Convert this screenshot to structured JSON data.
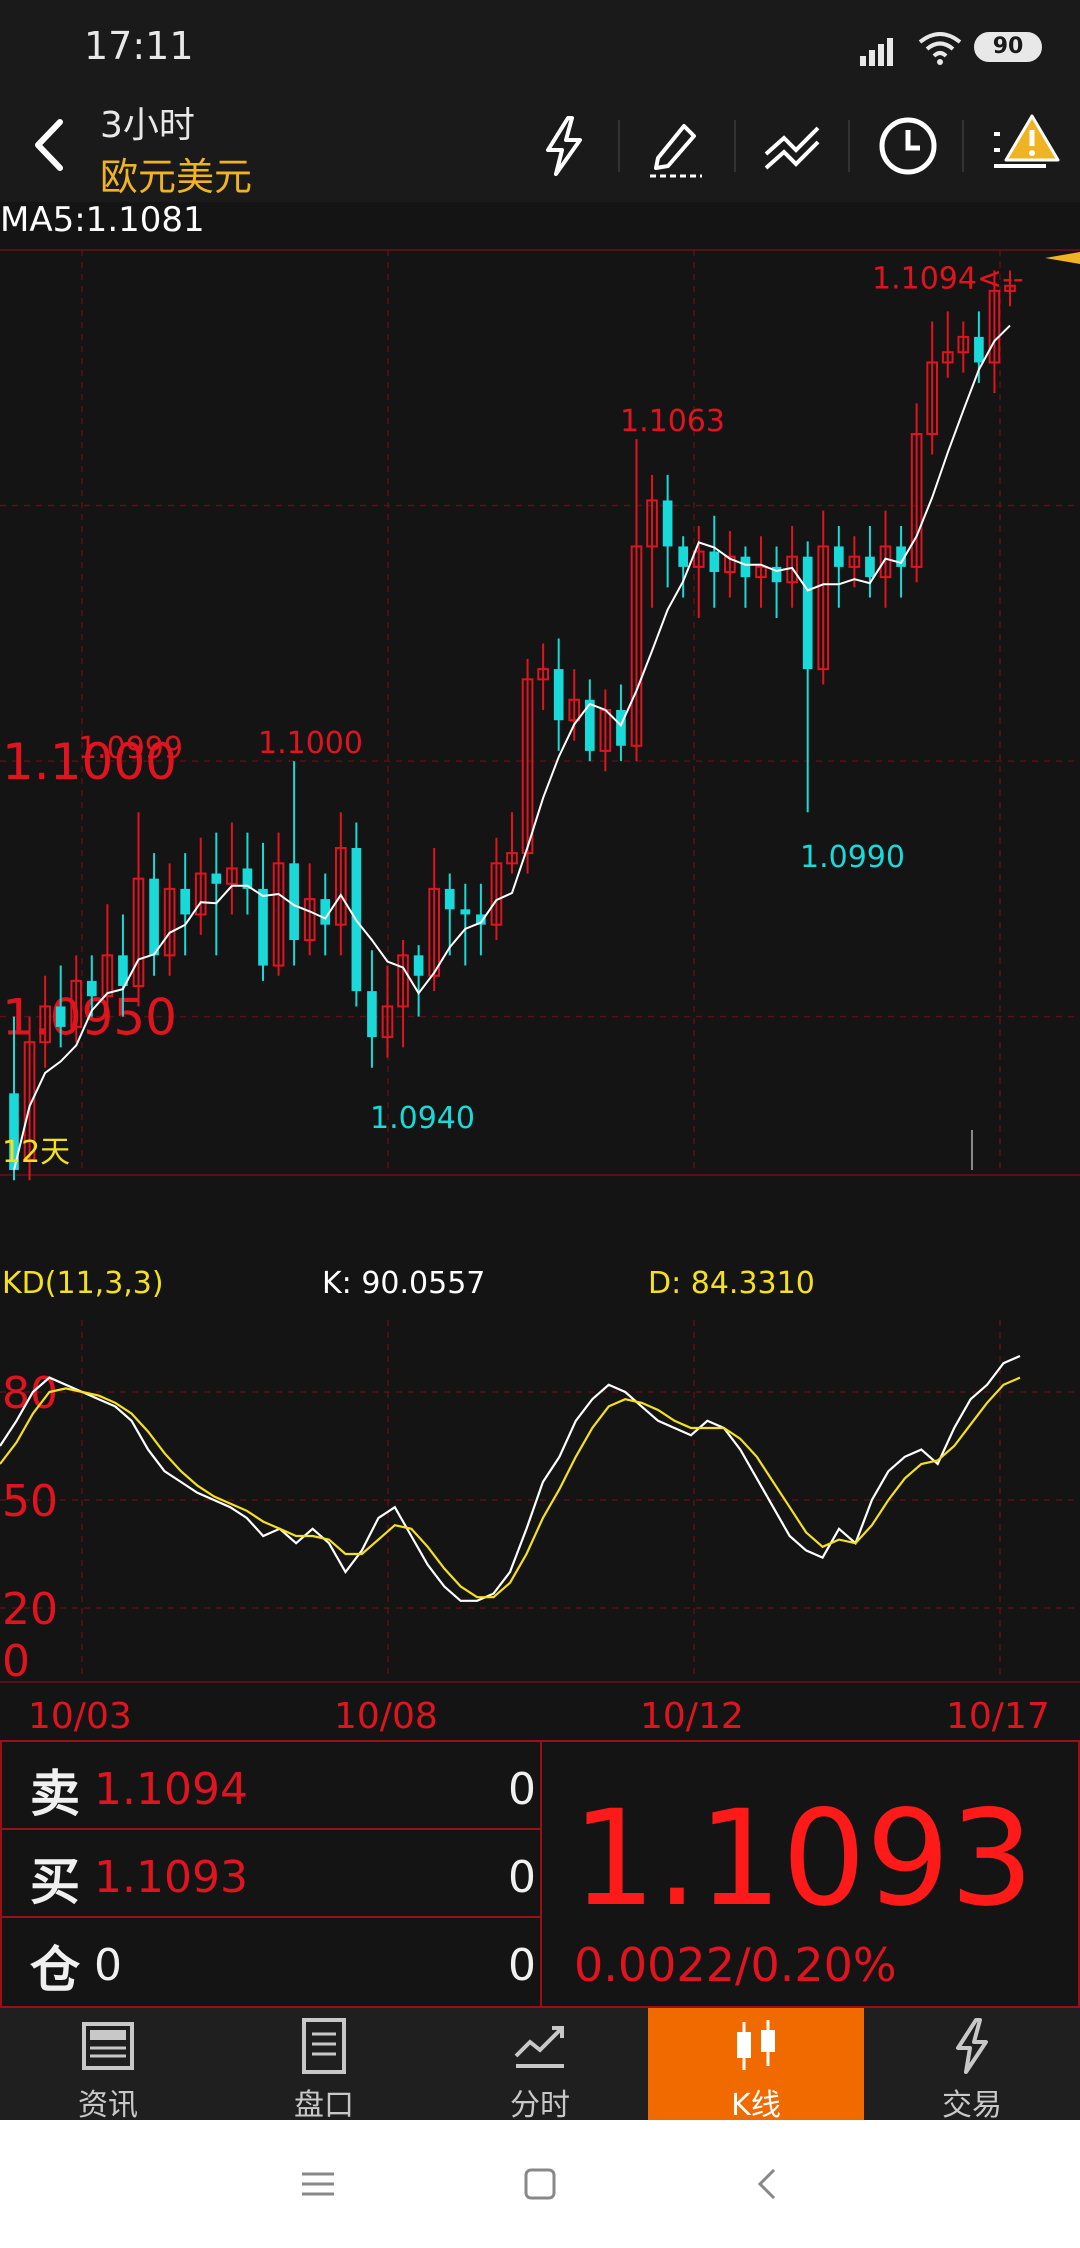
{
  "status": {
    "time": "17:11",
    "battery": "90"
  },
  "header": {
    "period": "3小时",
    "symbol": "欧元美元",
    "icons": [
      "lightning-icon",
      "pen-icon",
      "trendline-icon",
      "clock-icon",
      "alert-icon"
    ]
  },
  "ma_label": "MA5:1.1081",
  "chart_data": [
    {
      "type": "candlestick",
      "title": "",
      "ylim": [
        1.092,
        1.11
      ],
      "y_ticks": [
        "1.1000",
        "1.0950"
      ],
      "x_ticks": [
        "10/03",
        "10/08",
        "10/12",
        "10/17"
      ],
      "annotations": [
        {
          "text": "1.0999",
          "value": 1.0999,
          "color": "#e0141f"
        },
        {
          "text": "1.1000",
          "value": 1.1,
          "color": "#e0141f"
        },
        {
          "text": "1.1063",
          "value": 1.1063,
          "color": "#e0141f"
        },
        {
          "text": "1.1094<--",
          "value": 1.1094,
          "color": "#e0141f"
        },
        {
          "text": "1.0940",
          "value": 1.094,
          "color": "#19d9d9"
        },
        {
          "text": "1.0990",
          "value": 1.099,
          "color": "#19d9d9"
        }
      ],
      "period_label": "12天",
      "series": [
        {
          "name": "MA5",
          "color": "#ffffff"
        }
      ],
      "candles": [
        [
          1.0935,
          1.092,
          1.095,
          1.0918
        ],
        [
          1.0922,
          1.0945,
          1.095,
          1.0918
        ],
        [
          1.0945,
          1.0952,
          1.0958,
          1.094
        ],
        [
          1.0952,
          1.0948,
          1.096,
          1.0944
        ],
        [
          1.0948,
          1.0957,
          1.0962,
          1.0945
        ],
        [
          1.0957,
          1.0954,
          1.0962,
          1.095
        ],
        [
          1.0954,
          1.0962,
          1.0972,
          1.0948
        ],
        [
          1.0962,
          1.0956,
          1.097,
          1.095
        ],
        [
          1.0956,
          1.0977,
          1.099,
          1.0952
        ],
        [
          1.0977,
          1.0962,
          1.0982,
          1.0958
        ],
        [
          1.0962,
          1.0975,
          1.098,
          1.0958
        ],
        [
          1.0975,
          1.097,
          1.0982,
          1.0962
        ],
        [
          1.097,
          1.0978,
          1.0985,
          1.0966
        ],
        [
          1.0978,
          1.0976,
          1.0986,
          1.0962
        ],
        [
          1.0976,
          1.0979,
          1.0988,
          1.097
        ],
        [
          1.0979,
          1.0975,
          1.0986,
          1.097
        ],
        [
          1.0975,
          1.096,
          1.0984,
          1.0957
        ],
        [
          1.096,
          1.098,
          1.0986,
          1.0958
        ],
        [
          1.098,
          1.0965,
          1.1,
          1.096
        ],
        [
          1.0965,
          1.0973,
          1.098,
          1.0962
        ],
        [
          1.0973,
          1.0968,
          1.0978,
          1.0962
        ],
        [
          1.0968,
          1.0983,
          1.099,
          1.0962
        ],
        [
          1.0983,
          1.0955,
          1.0988,
          1.0952
        ],
        [
          1.0955,
          1.0946,
          1.0963,
          1.094
        ],
        [
          1.0946,
          1.0952,
          1.096,
          1.0942
        ],
        [
          1.0952,
          1.0962,
          1.0965,
          1.0944
        ],
        [
          1.0962,
          1.0958,
          1.0964,
          1.095
        ],
        [
          1.0958,
          1.0975,
          1.0983,
          1.0955
        ],
        [
          1.0975,
          1.0971,
          1.0978,
          1.0962
        ],
        [
          1.0971,
          1.097,
          1.0976,
          1.096
        ],
        [
          1.097,
          1.0968,
          1.0976,
          1.0962
        ],
        [
          1.0968,
          1.098,
          1.0985,
          1.0965
        ],
        [
          1.098,
          1.0982,
          1.099,
          1.0978
        ],
        [
          1.0982,
          1.1016,
          1.102,
          1.0978
        ],
        [
          1.1016,
          1.1018,
          1.1023,
          1.101
        ],
        [
          1.1018,
          1.1008,
          1.1024,
          1.1002
        ],
        [
          1.1008,
          1.1012,
          1.1018,
          1.1004
        ],
        [
          1.1012,
          1.1002,
          1.1016,
          1.1
        ],
        [
          1.1002,
          1.101,
          1.1014,
          1.0998
        ],
        [
          1.101,
          1.1003,
          1.1015,
          1.1
        ],
        [
          1.1003,
          1.1042,
          1.1063,
          1.1
        ],
        [
          1.1042,
          1.1051,
          1.1056,
          1.103
        ],
        [
          1.1051,
          1.1042,
          1.1056,
          1.1034
        ],
        [
          1.1042,
          1.1038,
          1.1044,
          1.1032
        ],
        [
          1.1038,
          1.1041,
          1.1046,
          1.1028
        ],
        [
          1.1041,
          1.1037,
          1.1048,
          1.103
        ],
        [
          1.1037,
          1.104,
          1.1045,
          1.1032
        ],
        [
          1.104,
          1.1036,
          1.1042,
          1.103
        ],
        [
          1.1036,
          1.1038,
          1.1044,
          1.103
        ],
        [
          1.1038,
          1.1035,
          1.1042,
          1.1028
        ],
        [
          1.1035,
          1.104,
          1.1046,
          1.103
        ],
        [
          1.104,
          1.1018,
          1.1043,
          1.099
        ],
        [
          1.1018,
          1.1042,
          1.1049,
          1.1015
        ],
        [
          1.1042,
          1.1038,
          1.1046,
          1.103
        ],
        [
          1.1038,
          1.104,
          1.1044,
          1.1034
        ],
        [
          1.104,
          1.1036,
          1.1046,
          1.1032
        ],
        [
          1.1036,
          1.1042,
          1.1049,
          1.103
        ],
        [
          1.1042,
          1.1038,
          1.1046,
          1.1032
        ],
        [
          1.1038,
          1.1064,
          1.107,
          1.1035
        ],
        [
          1.1064,
          1.1078,
          1.1086,
          1.106
        ],
        [
          1.1078,
          1.108,
          1.1088,
          1.1075
        ],
        [
          1.108,
          1.1083,
          1.1086,
          1.1076
        ],
        [
          1.1083,
          1.1078,
          1.1088,
          1.1074
        ],
        [
          1.1078,
          1.1092,
          1.1096,
          1.1072
        ],
        [
          1.1092,
          1.1093,
          1.1096,
          1.1089
        ]
      ]
    },
    {
      "type": "line",
      "title": "KD(11,3,3)",
      "ylim": [
        0,
        100
      ],
      "y_ticks": [
        "80",
        "50",
        "20",
        "0"
      ],
      "series": [
        {
          "name": "K",
          "color": "#ffffff",
          "values": [
            65,
            72,
            80,
            84,
            82,
            80,
            78,
            76,
            72,
            64,
            58,
            55,
            52,
            50,
            48,
            45,
            40,
            42,
            38,
            42,
            38,
            30,
            36,
            45,
            48,
            40,
            32,
            26,
            22,
            22,
            24,
            30,
            42,
            55,
            62,
            72,
            78,
            82,
            80,
            76,
            72,
            70,
            68,
            72,
            70,
            64,
            56,
            48,
            40,
            36,
            34,
            42,
            38,
            50,
            58,
            62,
            64,
            60,
            70,
            78,
            82,
            88,
            90
          ]
        },
        {
          "name": "D",
          "color": "#f5e020",
          "values": [
            60,
            66,
            74,
            80,
            81,
            80,
            79,
            77,
            74,
            69,
            63,
            58,
            54,
            51,
            49,
            47,
            44,
            42,
            40,
            40,
            39,
            35,
            35,
            39,
            43,
            42,
            37,
            31,
            26,
            23,
            23,
            27,
            35,
            45,
            53,
            62,
            70,
            76,
            78,
            77,
            75,
            72,
            70,
            70,
            70,
            67,
            62,
            55,
            48,
            41,
            37,
            39,
            38,
            43,
            50,
            56,
            60,
            61,
            65,
            71,
            77,
            82,
            84
          ]
        }
      ],
      "k_label": "K: 90.0557",
      "d_label": "D: 84.3310"
    }
  ],
  "kd": {
    "title": "KD(11,3,3)",
    "k": "K: 90.0557",
    "d": "D: 84.3310"
  },
  "dates": [
    "10/03",
    "10/08",
    "10/12",
    "10/17"
  ],
  "quote": {
    "sell_label": "卖",
    "sell_price": "1.1094",
    "sell_qty": "0",
    "buy_label": "买",
    "buy_price": "1.1093",
    "buy_qty": "0",
    "pos_label": "仓",
    "pos_value": "0",
    "pos_qty": "0",
    "last_price": "1.1093",
    "change": "0.0022/0.20%"
  },
  "tabs": [
    {
      "label": "资讯",
      "icon": "news-icon",
      "active": false
    },
    {
      "label": "盘口",
      "icon": "orderbook-icon",
      "active": false
    },
    {
      "label": "分时",
      "icon": "intraday-icon",
      "active": false
    },
    {
      "label": "K线",
      "icon": "candlestick-icon",
      "active": true
    },
    {
      "label": "交易",
      "icon": "trade-icon",
      "active": false
    }
  ],
  "colors": {
    "up": "#e0141f",
    "down": "#19d9d9",
    "ma": "#ffffff",
    "accent": "#f06a00",
    "gold": "#f0b323"
  }
}
